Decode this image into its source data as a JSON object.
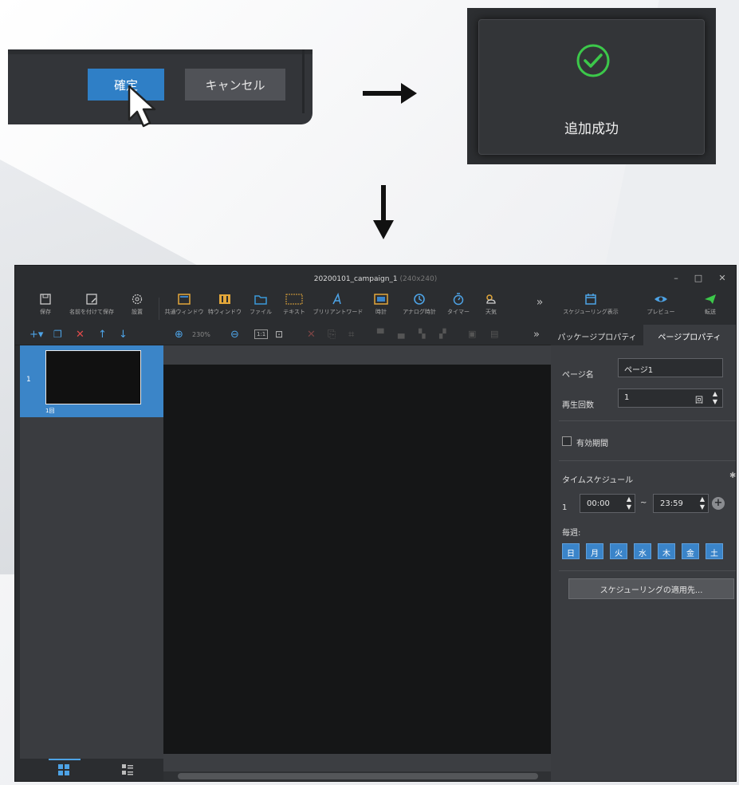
{
  "dialog": {
    "confirm_label": "確定",
    "cancel_label": "キャンセル"
  },
  "toast": {
    "message": "追加成功"
  },
  "window": {
    "title": "20200101_campaign_1",
    "title_suffix": "(240x240)"
  },
  "toolbar": {
    "items": [
      {
        "label": "保存"
      },
      {
        "label": "名前を付けて保存"
      },
      {
        "label": "設置"
      },
      {
        "label": "共通ウィンドウ"
      },
      {
        "label": "特ウィンドウ"
      },
      {
        "label": "ファイル"
      },
      {
        "label": "テキスト"
      },
      {
        "label": "ブリリアントワード"
      },
      {
        "label": "時計"
      },
      {
        "label": "アナログ時計"
      },
      {
        "label": "タイマー"
      },
      {
        "label": "天気"
      },
      {
        "label": "スケジューリング表示"
      },
      {
        "label": "プレビュー"
      },
      {
        "label": "転送"
      }
    ],
    "more": "»",
    "text_icon_label": "Text"
  },
  "subbar": {
    "zoom": "230%",
    "fit_label": "1:1",
    "more": "»"
  },
  "page_list": {
    "items": [
      {
        "number": "1",
        "count": "1回"
      }
    ]
  },
  "tabs": {
    "package": "パッケージプロパティ",
    "page": "ページプロパティ"
  },
  "props": {
    "page_name_label": "ページ名",
    "page_name_value": "ページ1",
    "play_count_label": "再生回数",
    "play_count_value": "1",
    "play_count_unit": "回",
    "validity_label": "有効期間",
    "schedule_label": "タイムスケジュール",
    "schedule_row": {
      "index": "1",
      "start": "00:00",
      "sep": "~",
      "end": "23:59"
    },
    "weekly_label": "毎週:",
    "days": [
      "日",
      "月",
      "火",
      "水",
      "木",
      "金",
      "土"
    ],
    "apply_label": "スケジューリングの適用先..."
  },
  "colors": {
    "accent": "#2f7fc6",
    "success": "#3cc84a",
    "transfer": "#3cc84a",
    "danger": "#e14b4b"
  }
}
